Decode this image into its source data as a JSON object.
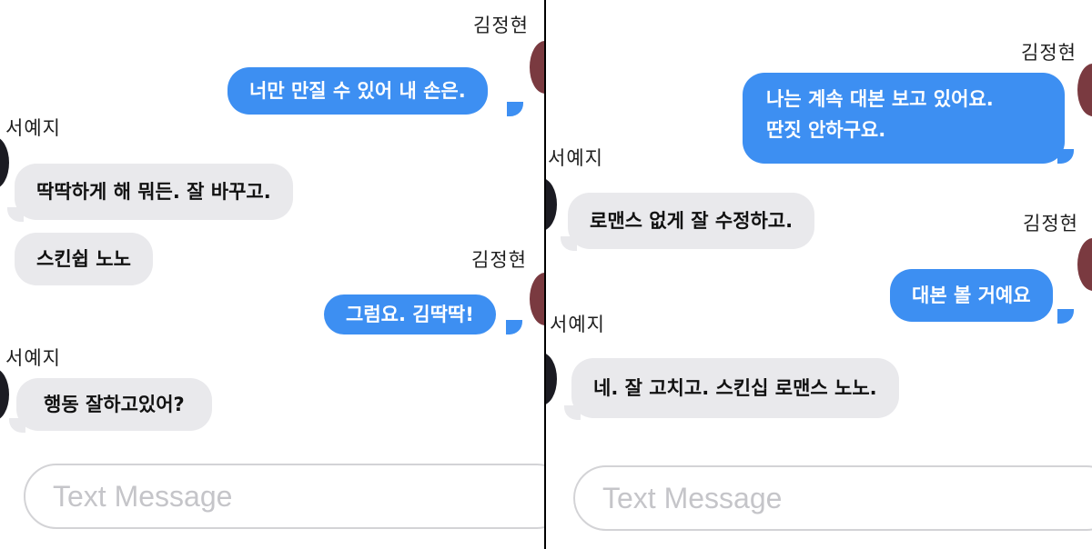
{
  "left_panel": {
    "messages": [
      {
        "sender": "김정현",
        "text": "너만 만질 수 있어 내 손은."
      },
      {
        "sender": "서예지",
        "text": "딱딱하게 해 뭐든. 잘 바꾸고."
      },
      {
        "text": "스킨쉽 노노"
      },
      {
        "sender": "김정현",
        "text": "그럼요. 김딱딱!"
      },
      {
        "sender": "서예지",
        "text": "행동 잘하고있어?"
      }
    ],
    "input_placeholder": "Text Message"
  },
  "right_panel": {
    "messages": [
      {
        "sender": "김정현",
        "text_line1": "나는 계속 대본 보고 있어요.",
        "text_line2": "딴짓 안하구요."
      },
      {
        "sender": "서예지",
        "text": "로맨스 없게 잘 수정하고."
      },
      {
        "sender": "김정현",
        "text": "대본 볼 거예요"
      },
      {
        "sender": "서예지",
        "text": "네. 잘 고치고. 스킨십 로맨스 노노."
      }
    ],
    "input_placeholder": "Text Message"
  },
  "colors": {
    "sent_bubble": "#3d8ff2",
    "received_bubble": "#e9e9ec",
    "divider": "#000000"
  }
}
